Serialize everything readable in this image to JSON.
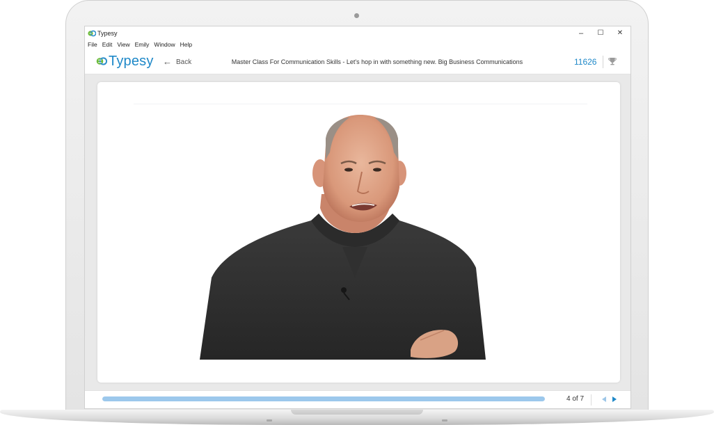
{
  "window": {
    "title": "Typesy",
    "controls": {
      "minimize": "–",
      "maximize": "☐",
      "close": "✕"
    }
  },
  "menu": {
    "items": [
      "File",
      "Edit",
      "View",
      "Emily",
      "Window",
      "Help"
    ]
  },
  "header": {
    "brand": "Typesy",
    "back_label": "Back",
    "lesson_title": "Master Class For Communication Skills - Let's hop in with something new. Big Business Communications",
    "score": "11626"
  },
  "footer": {
    "progress_fraction": 1.0,
    "page_indicator": "4 of 7"
  },
  "colors": {
    "accent": "#1e88c8",
    "brand_green": "#6cbb3c",
    "progress": "#9cc8ec",
    "nav_arrow": "#1e88c8"
  },
  "icons": {
    "app": "typesy-logo-icon",
    "back": "arrow-left-icon",
    "trophy": "trophy-icon",
    "prev": "triangle-left-icon",
    "next": "triangle-right-icon"
  }
}
